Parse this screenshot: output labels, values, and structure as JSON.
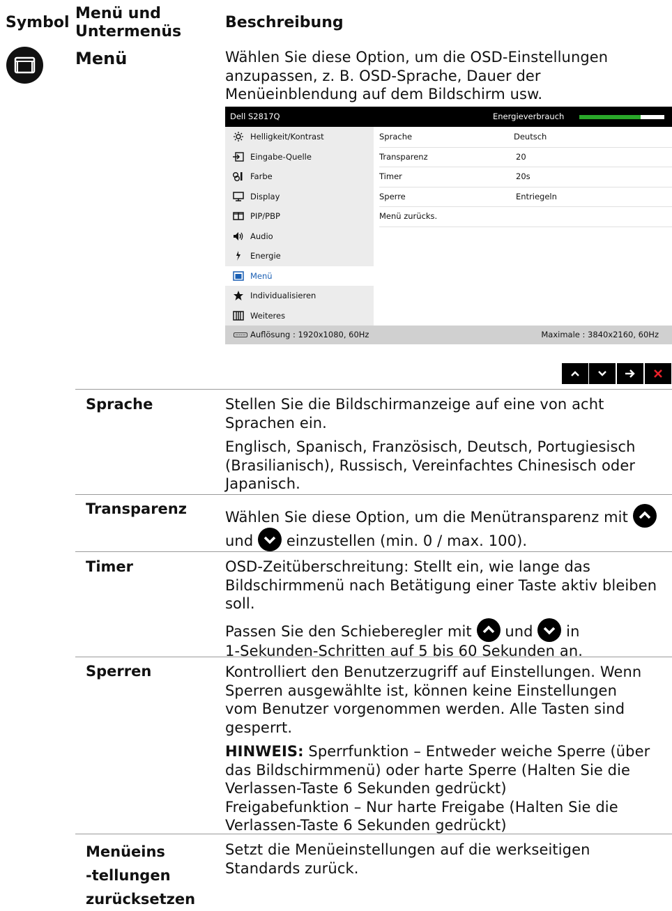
{
  "header": {
    "col_symbol": "Symbol",
    "col_menu_line1": "Menü und",
    "col_menu_line2": "Untermenüs",
    "col_desc": "Beschreibung"
  },
  "menu_entry": {
    "title": "Menü",
    "desc_lines": [
      "Wählen Sie diese Option, um die OSD-Einstellungen",
      "anzupassen, z. B. OSD-Sprache, Dauer der",
      "Menüeinblendung auf dem Bildschirm usw."
    ]
  },
  "osd": {
    "model": "Dell S2817Q",
    "energy_label": "Energieverbrauch",
    "energy_level": 0.72,
    "menu_items": [
      {
        "label": "Helligkeit/Kontrast",
        "icon": "brightness-icon"
      },
      {
        "label": "Eingabe-Quelle",
        "icon": "input-source-icon"
      },
      {
        "label": "Farbe",
        "icon": "color-icon"
      },
      {
        "label": "Display",
        "icon": "display-icon"
      },
      {
        "label": "PIP/PBP",
        "icon": "pip-pbp-icon"
      },
      {
        "label": "Audio",
        "icon": "audio-icon"
      },
      {
        "label": "Energie",
        "icon": "energy-icon"
      },
      {
        "label": "Menü",
        "icon": "menu-icon"
      },
      {
        "label": "Individualisieren",
        "icon": "star-icon"
      },
      {
        "label": "Weiteres",
        "icon": "others-icon"
      }
    ],
    "selected_index": 7,
    "settings": [
      {
        "name": "Sprache",
        "value": "Deutsch"
      },
      {
        "name": "Transparenz",
        "value": "20"
      },
      {
        "name": "Timer",
        "value": "20s"
      },
      {
        "name": "Sperre",
        "value": "Entriegeln"
      },
      {
        "name": "Menü zurücks.",
        "value": ""
      }
    ],
    "resolution": "Auflösung : 1920x1080, 60Hz",
    "max_resolution": "Maximale : 3840x2160, 60Hz"
  },
  "nav_buttons": [
    "up-icon",
    "down-icon",
    "right-arrow-icon",
    "close-icon"
  ],
  "accent_color": "#e8202a",
  "energy_color": "#2aa82a",
  "rows": {
    "sprache": {
      "label": "Sprache",
      "p1": [
        "Stellen Sie die Bildschirmanzeige auf eine von acht",
        "Sprachen ein."
      ],
      "p2": [
        "Englisch, Spanisch, Französisch, Deutsch, Portugiesisch",
        "(Brasilianisch), Russisch, Vereinfachtes Chinesisch oder",
        "Japanisch."
      ]
    },
    "transparenz": {
      "label": "Transparenz",
      "l1": "Wählen Sie diese Option, um die Menütransparenz mit",
      "l2a": "und",
      "l2b": "einzustellen (min. 0 / max. 100)."
    },
    "timer": {
      "label": "Timer",
      "p1": [
        "OSD-Zeitüberschreitung: Stellt ein, wie lange das",
        "Bildschirmmenü nach Betätigung einer Taste aktiv bleiben",
        "soll."
      ],
      "p2a": "Passen Sie den Schieberegler mit",
      "p2b": "und",
      "p2c": "in",
      "p2d": "1-Sekunden-Schritten auf 5 bis 60 Sekunden an."
    },
    "sperren": {
      "label": "Sperren",
      "p1": [
        "Kontrolliert den Benutzerzugriff auf Einstellungen. Wenn",
        "Sperren ausgewählte ist, können keine Einstellungen",
        "vom Benutzer vorgenommen werden. Alle Tasten sind",
        "gesperrt."
      ],
      "note_label": "HINWEIS:",
      "note_l1": "Sperrfunktion – Entweder weiche Sperre (über",
      "note_rest": [
        "das Bildschirmmenü) oder harte Sperre (Halten Sie die",
        "Verlassen-Taste 6 Sekunden gedrückt)",
        "Freigabefunktion – Nur harte Freigabe (Halten Sie die",
        "Verlassen-Taste 6 Sekunden gedrückt)"
      ]
    },
    "reset": {
      "label_lines": [
        "Menüeins",
        "-tellungen",
        "zurücksetzen"
      ],
      "p1": [
        "Setzt die Menüeinstellungen auf die werkseitigen",
        "Standards zurück."
      ]
    }
  }
}
